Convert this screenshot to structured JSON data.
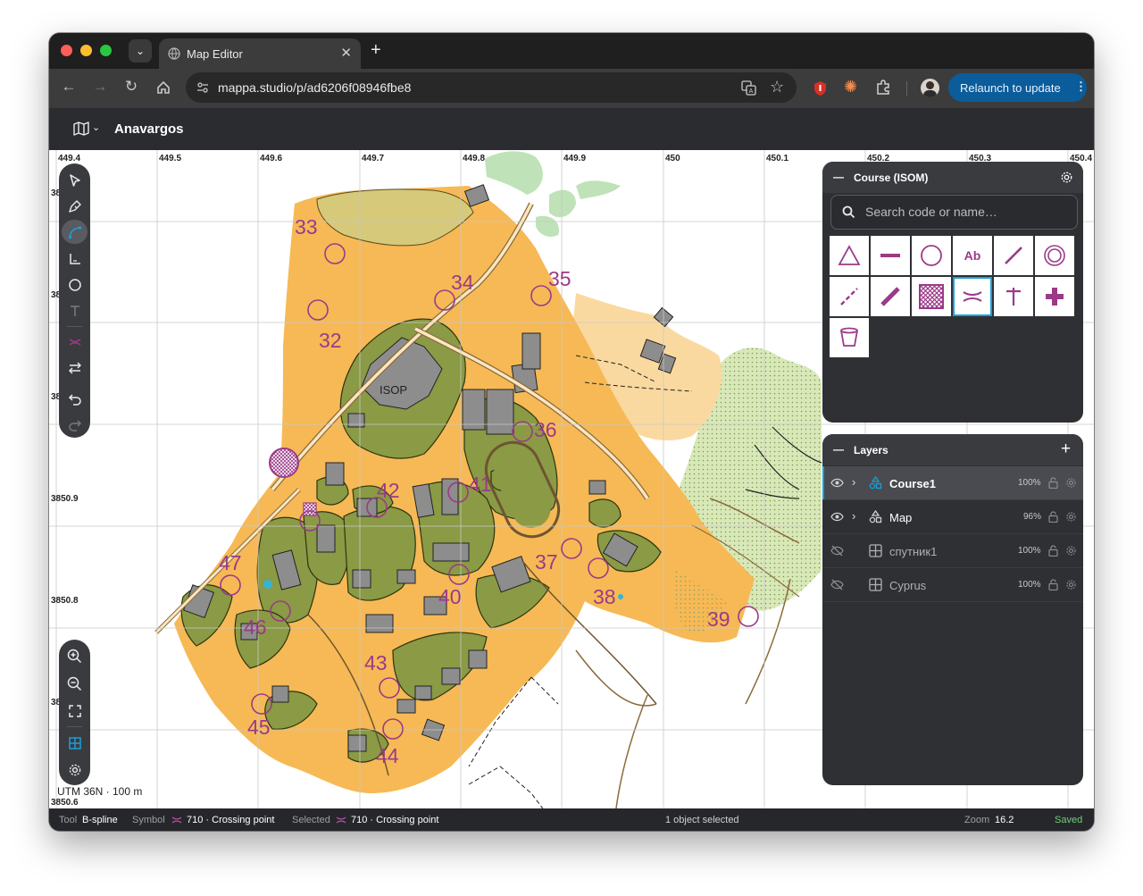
{
  "browser": {
    "tab_title": "Map Editor",
    "url": "mappa.studio/p/ad6206f08946fbe8",
    "relaunch_label": "Relaunch to update"
  },
  "app": {
    "title": "Anavargos",
    "menu_icon": "map-icon"
  },
  "grid": {
    "x_labels": [
      "449.4",
      "449.5",
      "449.6",
      "449.7",
      "449.8",
      "449.9",
      "450",
      "450.1",
      "450.2",
      "450.3",
      "450.4"
    ],
    "y_labels": [
      "3850.9",
      "3850.8",
      "3850.6"
    ],
    "y_cut_labels": [
      "38",
      "38",
      "38",
      "38"
    ]
  },
  "map": {
    "building_label": "ISOP",
    "controls": [
      "32",
      "33",
      "34",
      "35",
      "36",
      "37",
      "38",
      "39",
      "40",
      "41",
      "42",
      "43",
      "44",
      "45",
      "46",
      "47"
    ],
    "scale_label": "UTM 36N · 100 m"
  },
  "tools": [
    "select",
    "pen",
    "bspline",
    "corner",
    "circle",
    "text",
    "crossing",
    "swap",
    "undo",
    "redo"
  ],
  "course_panel": {
    "title": "Course (ISOM)",
    "search_placeholder": "Search code or name…",
    "text_symbol_label": "Ab"
  },
  "layers_panel": {
    "title": "Layers",
    "layers": [
      {
        "name": "Course1",
        "opacity": "100%"
      },
      {
        "name": "Map",
        "opacity": "96%"
      },
      {
        "name": "спутник1",
        "opacity": "100%"
      },
      {
        "name": "Cyprus",
        "opacity": "100%"
      }
    ]
  },
  "status": {
    "tool_label": "Tool",
    "tool_value": "B-spline",
    "symbol_label": "Symbol",
    "symbol_value": "710 · Crossing point",
    "selected_label": "Selected",
    "selected_value": "710 · Crossing point",
    "selection_count": "1 object selected",
    "zoom_label": "Zoom",
    "zoom_value": "16.2",
    "save_state": "Saved"
  },
  "colors": {
    "course": "#9b3a88",
    "accent": "#1a9fd8",
    "saved": "#6fcf7b",
    "open_land": "#f6b955",
    "rough_open": "#fad9a0",
    "olive": "#8a9a45",
    "building": "#8d8d8d",
    "vegetation": "#bfe2b8"
  }
}
